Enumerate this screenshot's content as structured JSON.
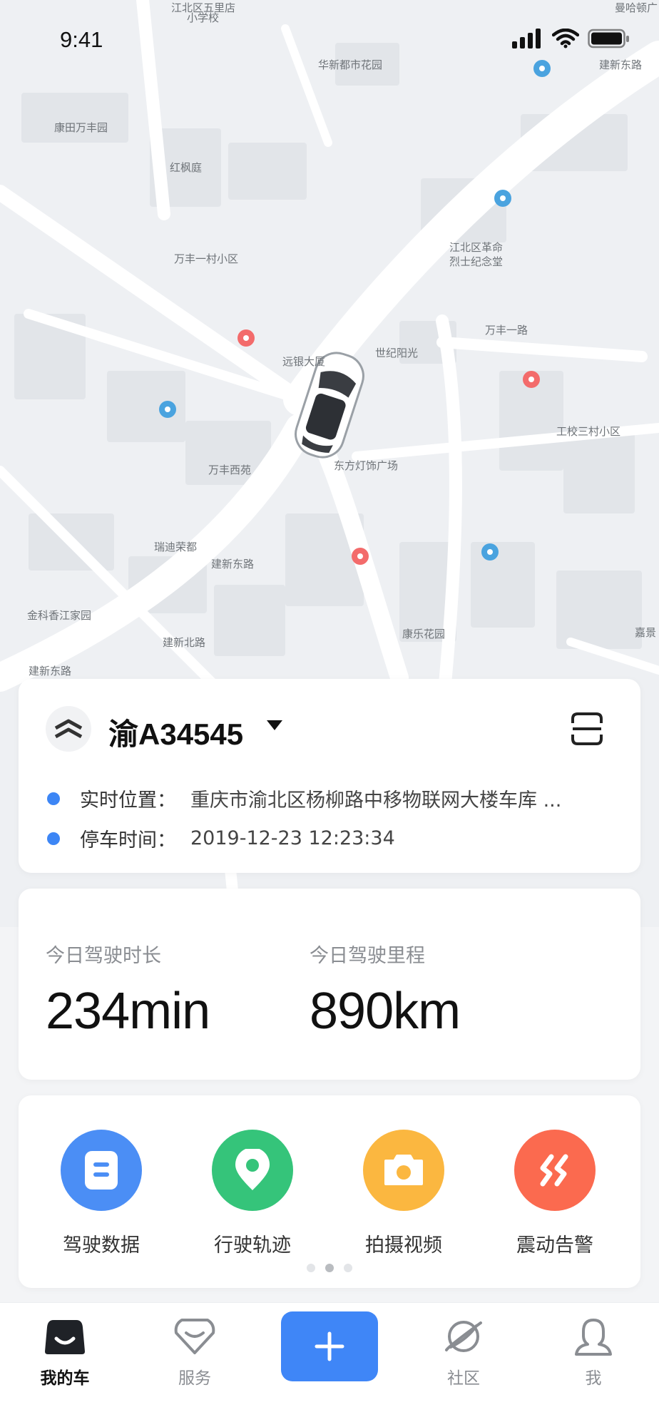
{
  "status_bar": {
    "time": "9:41"
  },
  "map": {
    "labels": [
      "江北区五里店",
      "小学校",
      "华新都市花园",
      "曼哈顿广",
      "康田万丰园",
      "红枫庭",
      "万丰一村小区",
      "江北区革命",
      "烈士纪念堂",
      "建新东路",
      "世纪阳光",
      "远银大厦",
      "万丰一路",
      "工校三村小区",
      "东方灯饰广场",
      "万丰西苑",
      "瑞迪荣都",
      "建新东路",
      "金科香江家园",
      "康乐花园",
      "建新东路",
      "建新北路",
      "嘉景"
    ]
  },
  "vehicle": {
    "plate": "渝A34545",
    "location_label": "实时位置：",
    "location_value": "重庆市渝北区杨柳路中移物联网大楼车库 ...",
    "parking_label": "停车时间：",
    "parking_value": "2019-12-23   12:23:34"
  },
  "stats": {
    "duration_label": "今日驾驶时长",
    "duration_value": "234min",
    "mileage_label": "今日驾驶里程",
    "mileage_value": "890km"
  },
  "functions": [
    {
      "label": "驾驶数据",
      "color": "#4b8ef5",
      "icon": "document-icon"
    },
    {
      "label": "行驶轨迹",
      "color": "#35c47a",
      "icon": "location-pin-icon"
    },
    {
      "label": "拍摄视频",
      "color": "#fbb740",
      "icon": "camera-icon"
    },
    {
      "label": "震动告警",
      "color": "#fb6a4f",
      "icon": "vibration-alert-icon"
    }
  ],
  "pager": {
    "pages": 3,
    "active": 1
  },
  "tabbar": {
    "tabs": [
      {
        "label": "我的车",
        "icon": "car-icon",
        "active": true
      },
      {
        "label": "服务",
        "icon": "service-heart-icon",
        "active": false
      },
      {
        "label": "社区",
        "icon": "planet-icon",
        "active": false
      },
      {
        "label": "我",
        "icon": "user-icon",
        "active": false
      }
    ],
    "add_icon": "plus-icon"
  },
  "colors": {
    "accent": "#3f86f7",
    "location_dot": "#3d86f5"
  }
}
